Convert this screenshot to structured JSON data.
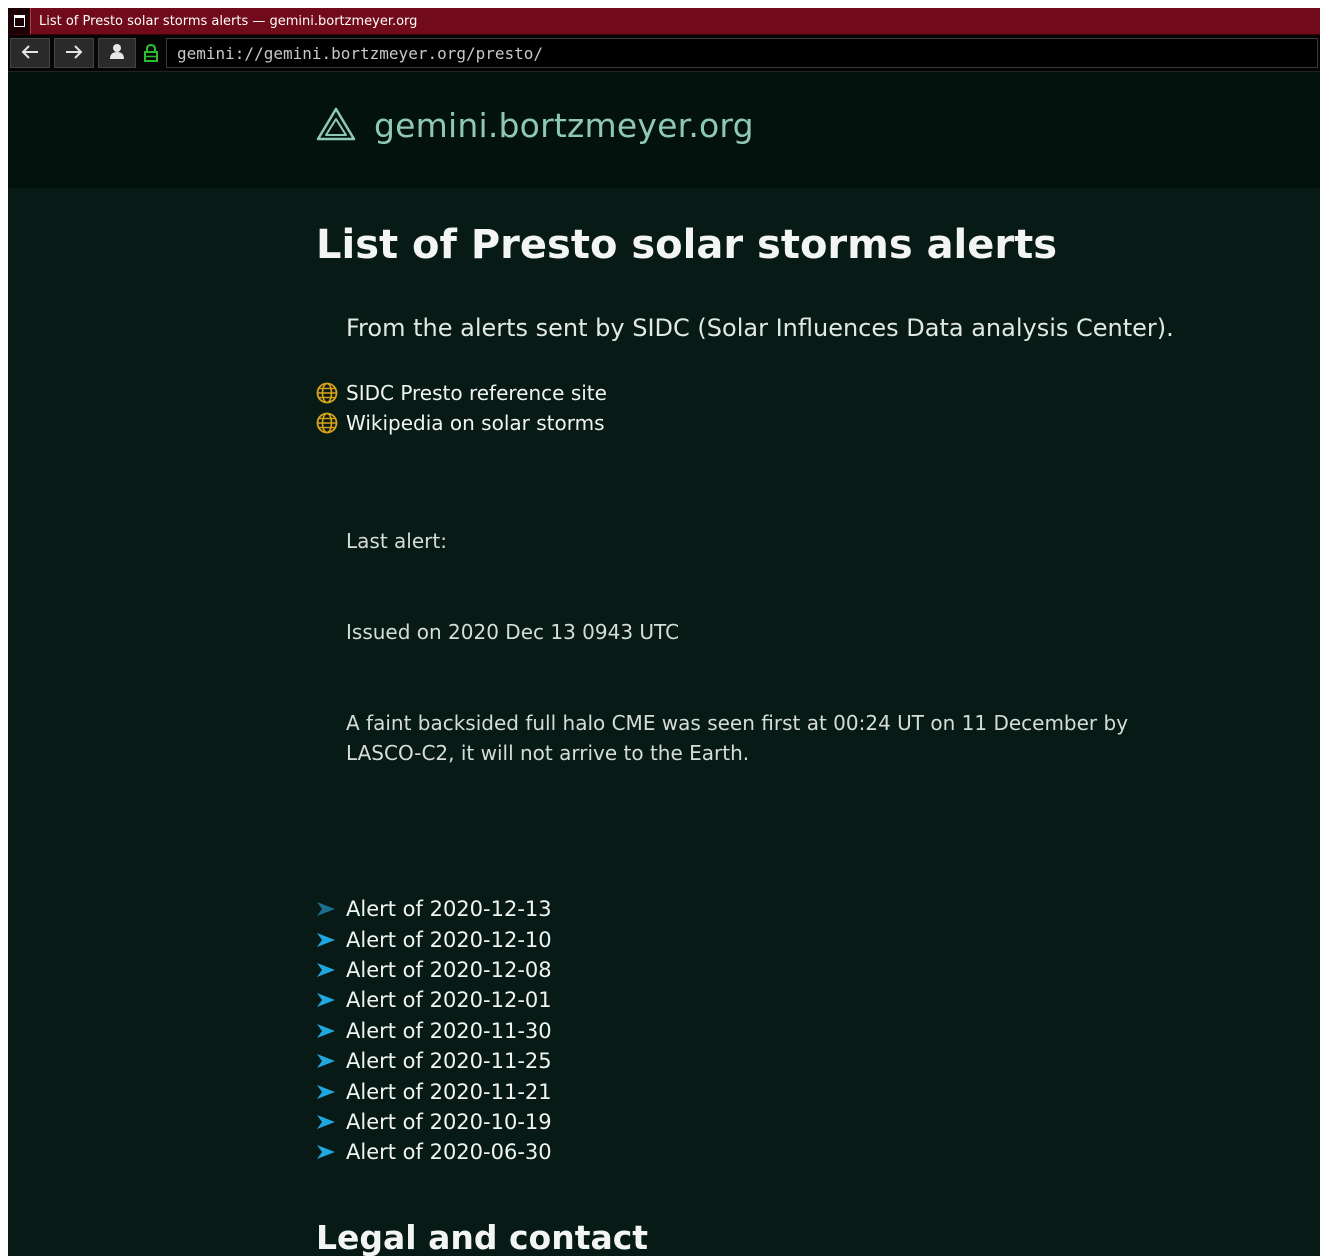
{
  "window": {
    "title": "List of Presto solar storms alerts — gemini.bortzmeyer.org"
  },
  "toolbar": {
    "back_icon": "arrow-left-icon",
    "forward_icon": "arrow-right-icon",
    "identity_icon": "user-icon",
    "lock_icon": "lock-icon",
    "url": "gemini://gemini.bortzmeyer.org/presto/"
  },
  "header": {
    "logo_icon": "gemini-triangle-icon",
    "site_name": "gemini.bortzmeyer.org"
  },
  "main": {
    "title": "List of Presto solar storms alerts",
    "intro": "From the alerts sent by SIDC (Solar Influences Data analysis Center).",
    "links": [
      {
        "label": "SIDC Presto reference site",
        "icon": "globe-icon"
      },
      {
        "label": "Wikipedia on solar storms",
        "icon": "globe-icon"
      }
    ],
    "last_alert_label": "Last alert:",
    "issued": "Issued on 2020 Dec 13 0943 UTC",
    "alert_text": "A faint backsided full halo CME was seen first at 00:24 UT on 11 December by LASCO-C2, it will not arrive to the Earth.",
    "alerts": [
      {
        "label": "Alert of 2020-12-13"
      },
      {
        "label": "Alert of 2020-12-10"
      },
      {
        "label": "Alert of 2020-12-08"
      },
      {
        "label": "Alert of 2020-12-01"
      },
      {
        "label": "Alert of 2020-11-30"
      },
      {
        "label": "Alert of 2020-11-25"
      },
      {
        "label": "Alert of 2020-11-21"
      },
      {
        "label": "Alert of 2020-10-19"
      },
      {
        "label": "Alert of 2020-06-30"
      }
    ],
    "legal_title": "Legal and contact"
  },
  "colors": {
    "titlebar": "#710a1a",
    "page_background": "#071a15",
    "header_background": "#04120e",
    "site_name": "#8fc9b3",
    "globe": "#d9a21b",
    "arrow_active": "#1fa8e0",
    "arrow_visited": "#1f6e8f",
    "lock": "#2ebd2e"
  }
}
